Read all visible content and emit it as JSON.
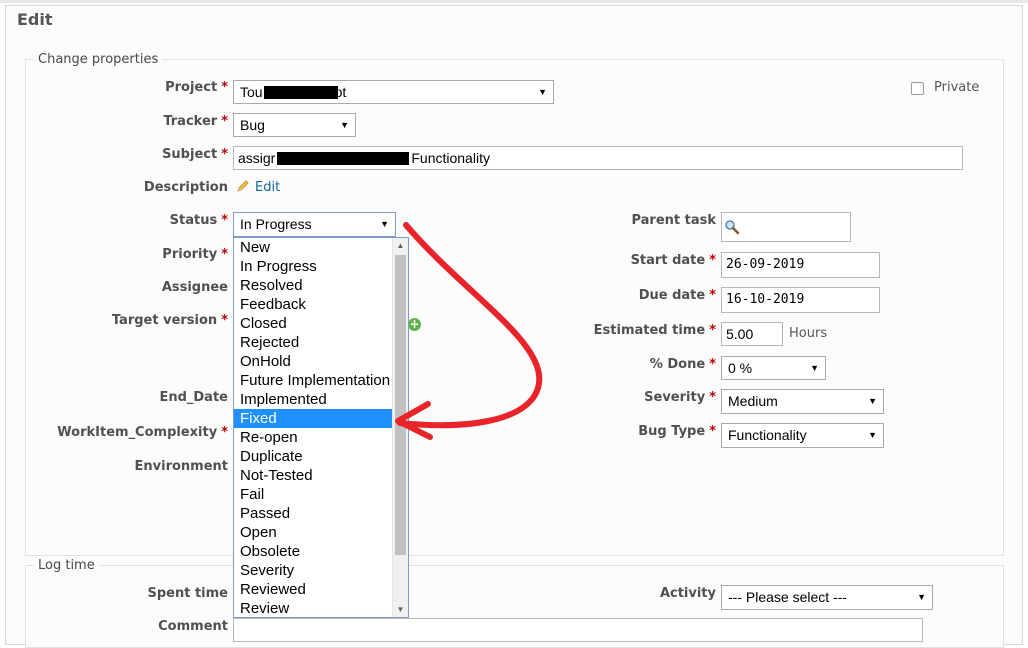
{
  "page": {
    "title": "Edit"
  },
  "change_properties": {
    "legend": "Change properties",
    "project": {
      "label": "Project",
      "value_prefix": "Tou",
      "value_suffix": "ot"
    },
    "private": {
      "label": "Private",
      "checked": false
    },
    "tracker": {
      "label": "Tracker",
      "value": "Bug"
    },
    "subject": {
      "label": "Subject",
      "value_prefix": "assigr",
      "value_suffix": "Functionality"
    },
    "description": {
      "label": "Description",
      "edit_label": "Edit"
    },
    "status": {
      "label": "Status",
      "value": "In Progress",
      "options": [
        "New",
        "In Progress",
        "Resolved",
        "Feedback",
        "Closed",
        "Rejected",
        "OnHold",
        "Future Implementation",
        "Implemented",
        "Fixed",
        "Re-open",
        "Duplicate",
        "Not-Tested",
        "Fail",
        "Passed",
        "Open",
        "Obsolete",
        "Severity",
        "Reviewed",
        "Review"
      ],
      "highlighted": "Fixed"
    },
    "priority": {
      "label": "Priority"
    },
    "assignee": {
      "label": "Assignee"
    },
    "target_version": {
      "label": "Target version"
    },
    "end_date": {
      "label": "End_Date"
    },
    "workitem_complexity": {
      "label": "WorkItem_Complexity"
    },
    "environment": {
      "label": "Environment"
    },
    "parent_task": {
      "label": "Parent task",
      "value": ""
    },
    "start_date": {
      "label": "Start date",
      "value": "26-09-2019"
    },
    "due_date": {
      "label": "Due date",
      "value": "16-10-2019"
    },
    "estimated_time": {
      "label": "Estimated time",
      "value": "5.00",
      "unit": "Hours"
    },
    "done_ratio": {
      "label": "% Done",
      "value": "0 %"
    },
    "severity": {
      "label": "Severity",
      "value": "Medium"
    },
    "bug_type": {
      "label": "Bug Type",
      "value": "Functionality"
    }
  },
  "log_time": {
    "legend": "Log time",
    "spent_time": {
      "label": "Spent time"
    },
    "activity": {
      "label": "Activity",
      "value": "--- Please select ---"
    },
    "comment": {
      "label": "Comment"
    }
  },
  "annotation": {
    "color": "#e8232a"
  },
  "icons": {
    "dropdown_arrow": "▼",
    "edit": "pencil-icon",
    "search": "magnifier-icon",
    "add": "plus-icon"
  }
}
